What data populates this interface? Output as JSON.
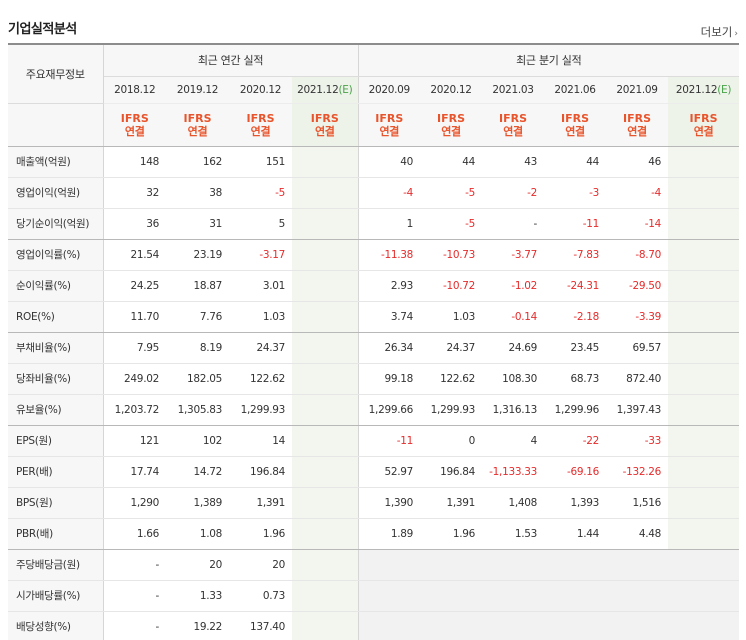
{
  "section_title": "기업실적분석",
  "more_link": "더보기",
  "more_chevron": "›",
  "header": {
    "stub": "주요재무정보",
    "annual_group": "최근 연간 실적",
    "quarter_group": "최근 분기 실적",
    "annual_periods": [
      "2018.12",
      "2019.12",
      "2020.12",
      "2021.12"
    ],
    "annual_estimate_mark": "(E)",
    "quarter_periods": [
      "2020.09",
      "2020.12",
      "2021.03",
      "2021.06",
      "2021.09",
      "2021.12"
    ],
    "quarter_estimate_mark": "(E)",
    "ifrs_top": "IFRS",
    "ifrs_bottom": "연결"
  },
  "rows": [
    {
      "label": "매출액(억원)",
      "annual": [
        "148",
        "162",
        "151",
        ""
      ],
      "quarter": [
        "40",
        "44",
        "43",
        "44",
        "46",
        ""
      ]
    },
    {
      "label": "영업이익(억원)",
      "annual": [
        "32",
        "38",
        "-5",
        ""
      ],
      "quarter": [
        "-4",
        "-5",
        "-2",
        "-3",
        "-4",
        ""
      ]
    },
    {
      "label": "당기순이익(억원)",
      "annual": [
        "36",
        "31",
        "5",
        ""
      ],
      "quarter": [
        "1",
        "-5",
        "-",
        "-11",
        "-14",
        ""
      ]
    },
    {
      "label": "영업이익률(%)",
      "annual": [
        "21.54",
        "23.19",
        "-3.17",
        ""
      ],
      "quarter": [
        "-11.38",
        "-10.73",
        "-3.77",
        "-7.83",
        "-8.70",
        ""
      ]
    },
    {
      "label": "순이익률(%)",
      "annual": [
        "24.25",
        "18.87",
        "3.01",
        ""
      ],
      "quarter": [
        "2.93",
        "-10.72",
        "-1.02",
        "-24.31",
        "-29.50",
        ""
      ]
    },
    {
      "label": "ROE(%)",
      "annual": [
        "11.70",
        "7.76",
        "1.03",
        ""
      ],
      "quarter": [
        "3.74",
        "1.03",
        "-0.14",
        "-2.18",
        "-3.39",
        ""
      ]
    },
    {
      "label": "부채비율(%)",
      "annual": [
        "7.95",
        "8.19",
        "24.37",
        ""
      ],
      "quarter": [
        "26.34",
        "24.37",
        "24.69",
        "23.45",
        "69.57",
        ""
      ]
    },
    {
      "label": "당좌비율(%)",
      "annual": [
        "249.02",
        "182.05",
        "122.62",
        ""
      ],
      "quarter": [
        "99.18",
        "122.62",
        "108.30",
        "68.73",
        "872.40",
        ""
      ]
    },
    {
      "label": "유보율(%)",
      "annual": [
        "1,203.72",
        "1,305.83",
        "1,299.93",
        ""
      ],
      "quarter": [
        "1,299.66",
        "1,299.93",
        "1,316.13",
        "1,299.96",
        "1,397.43",
        ""
      ]
    },
    {
      "label": "EPS(원)",
      "annual": [
        "121",
        "102",
        "14",
        ""
      ],
      "quarter": [
        "-11",
        "0",
        "4",
        "-22",
        "-33",
        ""
      ]
    },
    {
      "label": "PER(배)",
      "annual": [
        "17.74",
        "14.72",
        "196.84",
        ""
      ],
      "quarter": [
        "52.97",
        "196.84",
        "-1,133.33",
        "-69.16",
        "-132.26",
        ""
      ]
    },
    {
      "label": "BPS(원)",
      "annual": [
        "1,290",
        "1,389",
        "1,391",
        ""
      ],
      "quarter": [
        "1,390",
        "1,391",
        "1,408",
        "1,393",
        "1,516",
        ""
      ]
    },
    {
      "label": "PBR(배)",
      "annual": [
        "1.66",
        "1.08",
        "1.96",
        ""
      ],
      "quarter": [
        "1.89",
        "1.96",
        "1.53",
        "1.44",
        "4.48",
        ""
      ]
    },
    {
      "label": "주당배당금(원)",
      "annual": [
        "-",
        "20",
        "20",
        ""
      ],
      "quarter": [
        "",
        "",
        "",
        "",
        "",
        ""
      ]
    },
    {
      "label": "시가배당률(%)",
      "annual": [
        "-",
        "1.33",
        "0.73",
        ""
      ],
      "quarter": [
        "",
        "",
        "",
        "",
        "",
        ""
      ]
    },
    {
      "label": "배당성향(%)",
      "annual": [
        "-",
        "19.22",
        "137.40",
        ""
      ],
      "quarter": [
        "",
        "",
        "",
        "",
        "",
        ""
      ]
    }
  ],
  "colors": {
    "negative": "#e62b2b",
    "ifrs_label": "#e8542b",
    "estimate_mark": "#4aa24a",
    "estimate_column_bg": "#f2f6ef"
  }
}
